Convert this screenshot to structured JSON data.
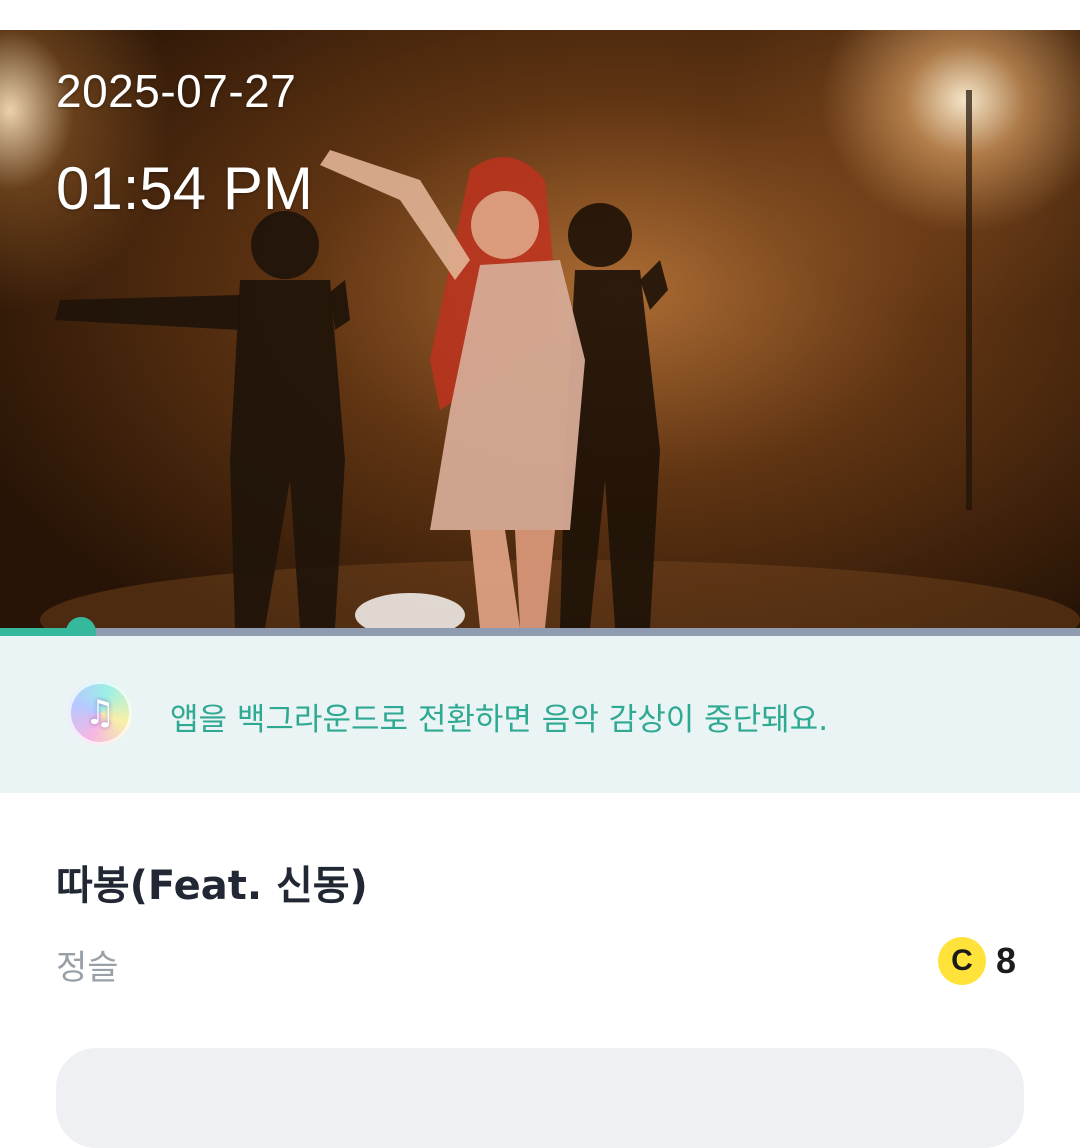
{
  "video": {
    "date": "2025-07-27",
    "time": "01:54 PM",
    "progress_fraction": 0.075
  },
  "notice": {
    "icon": "music-note-icon",
    "text": "앱을 백그라운드로 전환하면 음악 감상이 중단돼요."
  },
  "song": {
    "title": "따봉(Feat. 신동)",
    "artist": "정슬"
  },
  "coin": {
    "icon": "coin-c-icon",
    "symbol": "C",
    "count": "8"
  },
  "colors": {
    "accent": "#35b89c",
    "notice_bg": "#eaf4f4",
    "coin": "#ffe23a"
  }
}
